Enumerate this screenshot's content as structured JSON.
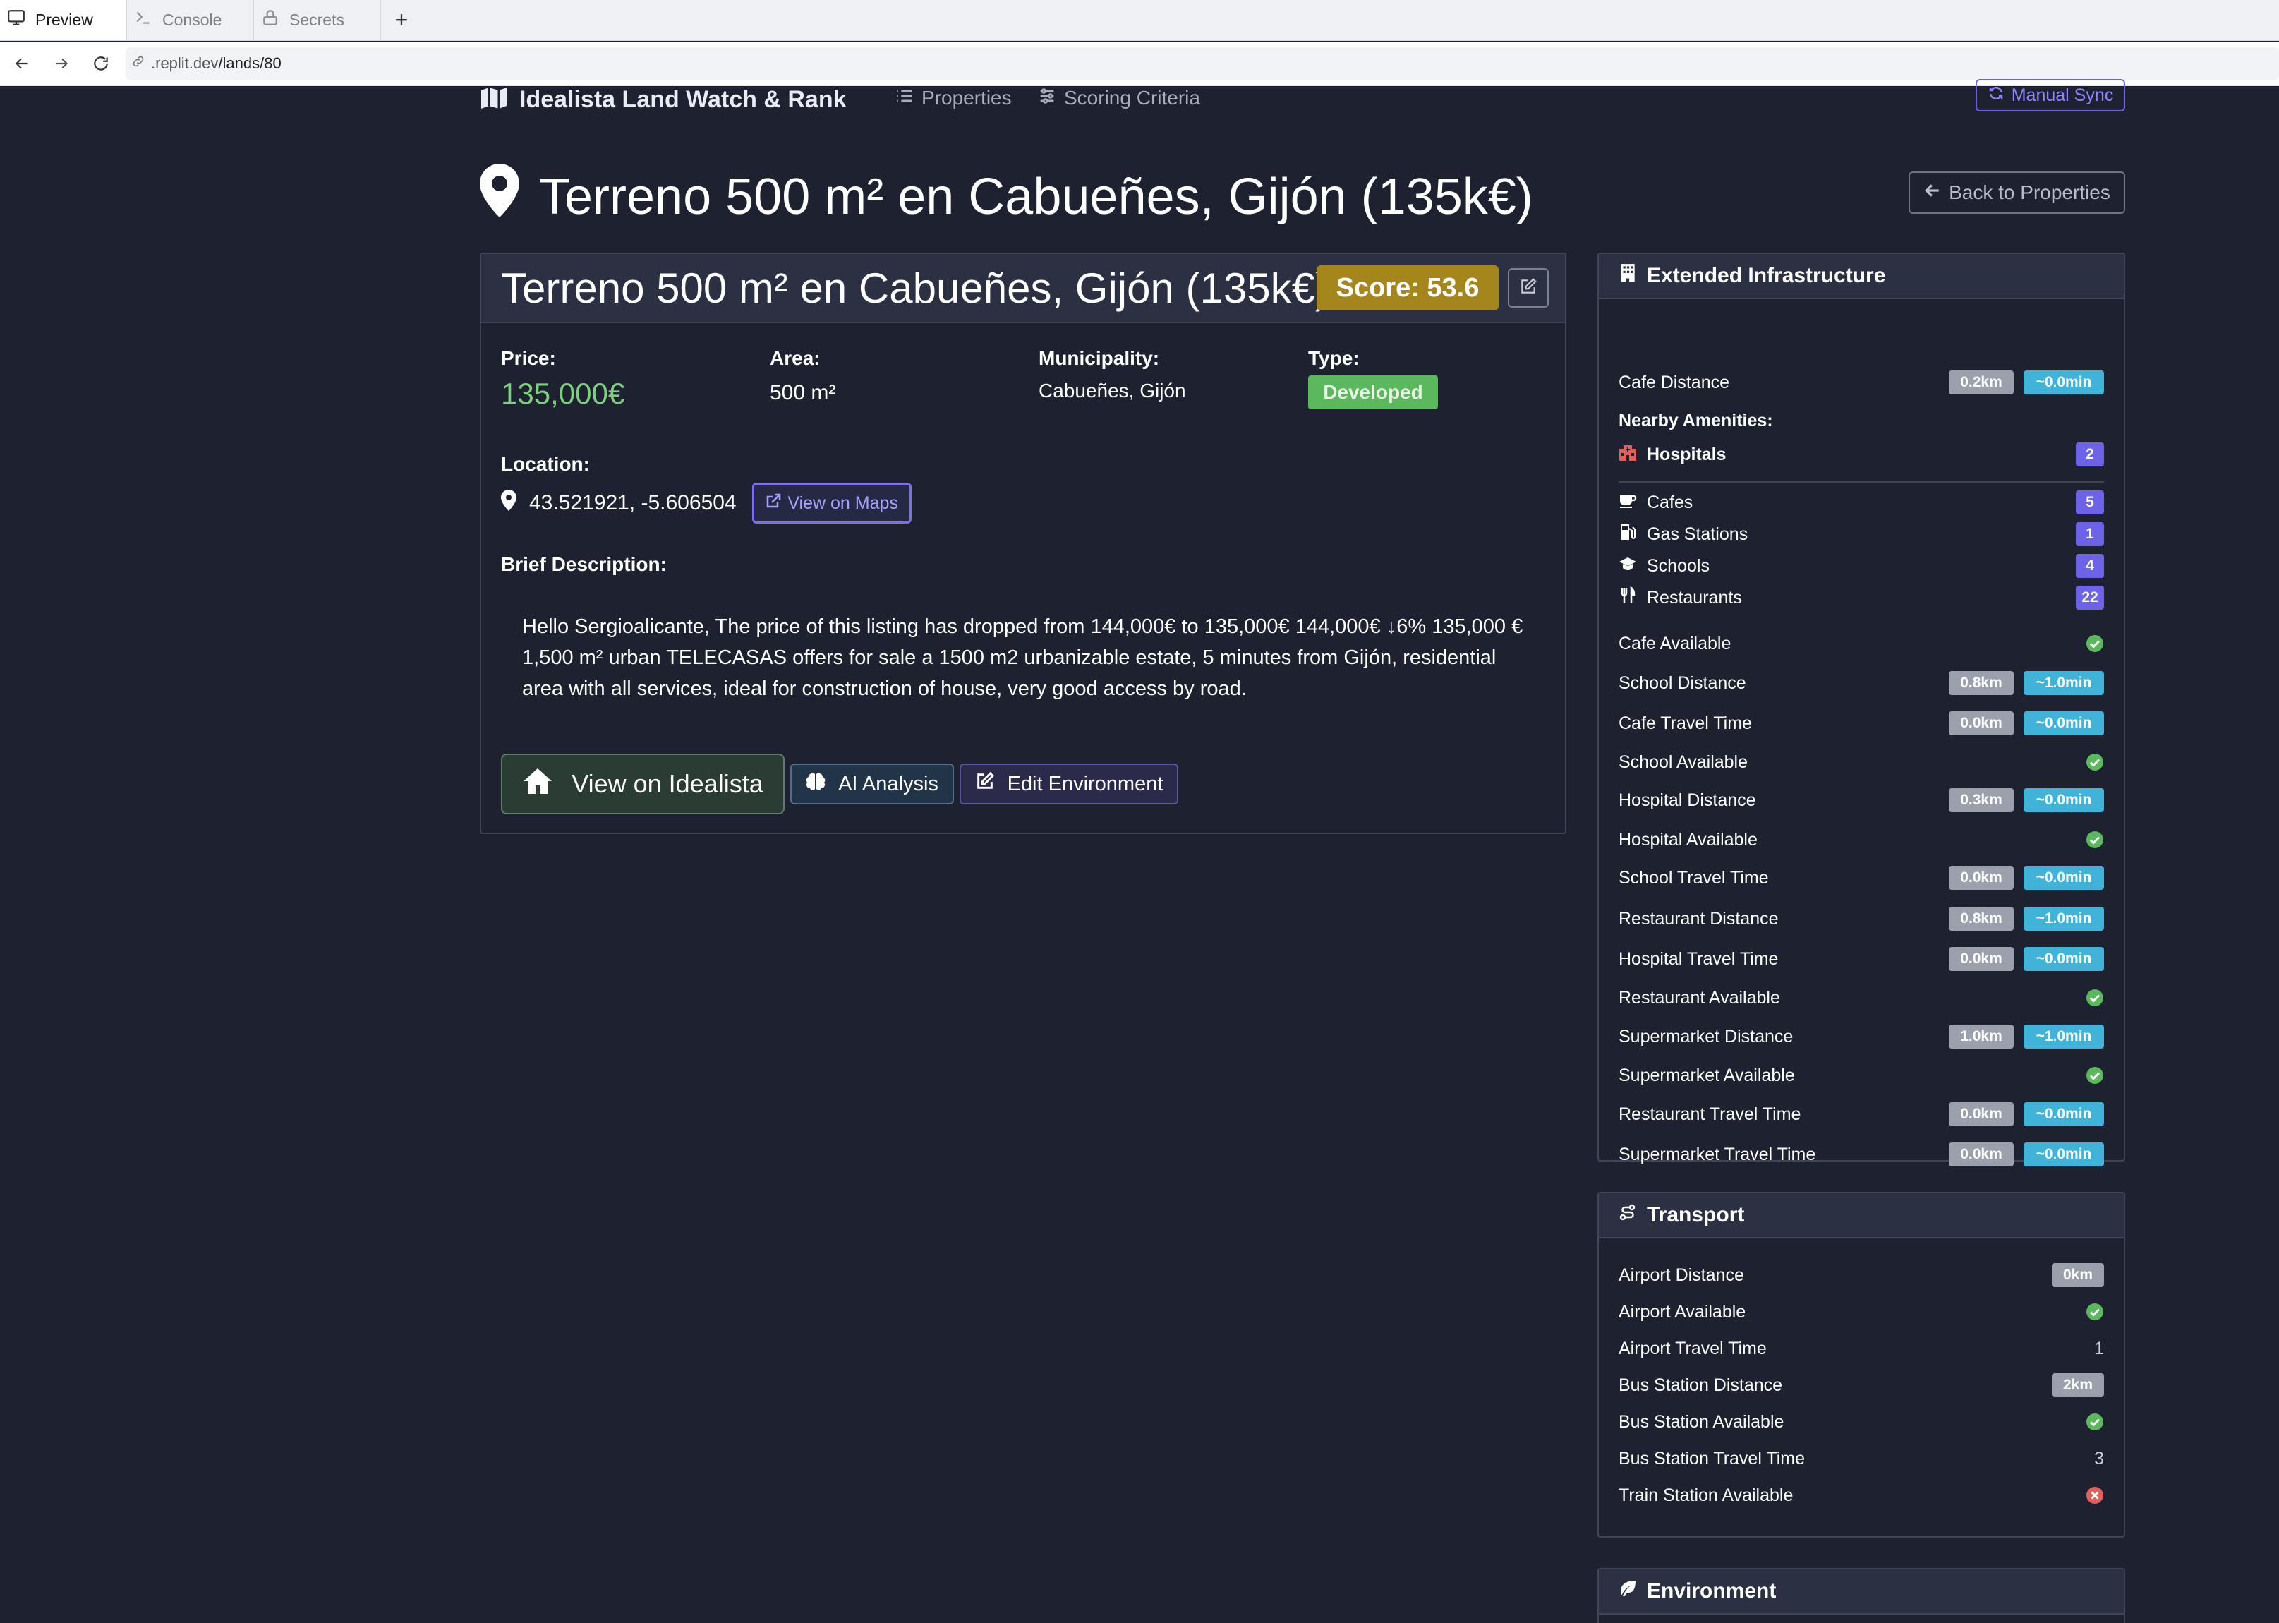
{
  "browser": {
    "tabs": [
      {
        "label": "Preview",
        "icon": "monitor-icon",
        "active": true
      },
      {
        "label": "Console",
        "icon": "terminal-icon",
        "active": false
      },
      {
        "label": "Secrets",
        "icon": "lock-icon",
        "active": false
      }
    ],
    "new_tab_label": "+",
    "url_host": ".replit.dev",
    "url_path": "/lands/80"
  },
  "nav": {
    "brand": "Idealista Land Watch & Rank",
    "links": [
      "Properties",
      "Scoring Criteria"
    ],
    "sync_label": "Manual Sync"
  },
  "page": {
    "title": "Terreno 500 m² en Cabueñes, Gijón (135k€)",
    "back_label": "Back to Properties"
  },
  "property": {
    "title": "Terreno 500 m² en Cabueñes, Gijón (135k€)",
    "score": "Score: 53.6",
    "price_label": "Price:",
    "price": "135,000€",
    "area_label": "Area:",
    "area": "500 m²",
    "municipality_label": "Municipality:",
    "municipality": "Cabueñes, Gijón",
    "type_label": "Type:",
    "type": "Developed",
    "location_label": "Location:",
    "coordinates": "43.521921, -5.606504",
    "maps_label": "View on Maps",
    "description_label": "Brief Description:",
    "description": "Hello Sergioalicante, The price of this listing has dropped from 144,000€ to 135,000€ 144,000€ ↓6% 135,000 € 1,500 m² urban TELECASAS offers for sale a 1500 m2 urbanizable estate, 5 minutes from Gijón, residential area with all services, ideal for construction of house, very good access by road.",
    "buttons": {
      "idealista": "View on Idealista",
      "ai": "AI Analysis",
      "env": "Edit Environment"
    }
  },
  "infrastructure": {
    "title": "Extended Infrastructure",
    "cafe_distance": {
      "label": "Cafe Distance",
      "km": "0.2km",
      "min": "~0.0min"
    },
    "amenities_label": "Nearby Amenities:",
    "hospitals": {
      "label": "Hospitals",
      "count": "2"
    },
    "amenities": [
      {
        "label": "Cafes",
        "count": "5",
        "icon": "cup-icon"
      },
      {
        "label": "Gas Stations",
        "count": "1",
        "icon": "gas-pump-icon"
      },
      {
        "label": "Schools",
        "count": "4",
        "icon": "graduation-cap-icon"
      },
      {
        "label": "Restaurants",
        "count": "22",
        "icon": "utensils-icon"
      }
    ],
    "rows": [
      {
        "label": "Cafe Available",
        "kind": "check"
      },
      {
        "label": "School Distance",
        "km": "0.8km",
        "min": "~1.0min"
      },
      {
        "label": "Cafe Travel Time",
        "km": "0.0km",
        "min": "~0.0min"
      },
      {
        "label": "School Available",
        "kind": "check"
      },
      {
        "label": "Hospital Distance",
        "km": "0.3km",
        "min": "~0.0min"
      },
      {
        "label": "Hospital Available",
        "kind": "check"
      },
      {
        "label": "School Travel Time",
        "km": "0.0km",
        "min": "~0.0min"
      },
      {
        "label": "Restaurant Distance",
        "km": "0.8km",
        "min": "~1.0min"
      },
      {
        "label": "Hospital Travel Time",
        "km": "0.0km",
        "min": "~0.0min"
      },
      {
        "label": "Restaurant Available",
        "kind": "check"
      },
      {
        "label": "Supermarket Distance",
        "km": "1.0km",
        "min": "~1.0min"
      },
      {
        "label": "Supermarket Available",
        "kind": "check"
      },
      {
        "label": "Restaurant Travel Time",
        "km": "0.0km",
        "min": "~0.0min"
      },
      {
        "label": "Supermarket Travel Time",
        "km": "0.0km",
        "min": "~0.0min"
      }
    ]
  },
  "transport": {
    "title": "Transport",
    "rows": [
      {
        "label": "Airport Distance",
        "pill": "0km"
      },
      {
        "label": "Airport Available",
        "kind": "check"
      },
      {
        "label": "Airport Travel Time",
        "value": "1"
      },
      {
        "label": "Bus Station Distance",
        "pill": "2km"
      },
      {
        "label": "Bus Station Available",
        "kind": "check"
      },
      {
        "label": "Bus Station Travel Time",
        "value": "3"
      },
      {
        "label": "Train Station Available",
        "kind": "cross"
      }
    ]
  },
  "environment": {
    "title": "Environment"
  },
  "colors": {
    "background": "#1d2130",
    "price_green": "#7dd17d",
    "score_gold": "#a4861d",
    "type_green": "#5cb85c",
    "accent_purple": "#6c63e8",
    "pill_cyan": "#41b3d9",
    "pill_grey": "#9aa1ad",
    "hospital_red": "#e0605c",
    "check_green": "#5cb85c",
    "cross_red": "#e0605c"
  }
}
